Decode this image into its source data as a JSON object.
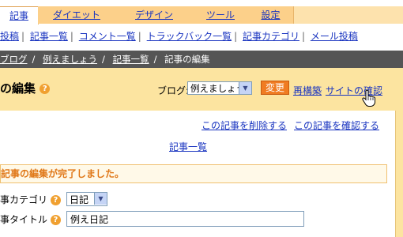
{
  "tabs": [
    "記事",
    "ダイエット",
    "デザイン",
    "ツール",
    "設定"
  ],
  "subnav": [
    "投稿",
    "記事一覧",
    "コメント一覧",
    "トラックバック一覧",
    "記事カテゴリ",
    "メール投稿"
  ],
  "breadcrumb": [
    "ブログ",
    "例えましょう",
    "記事一覧",
    "記事の編集"
  ],
  "page_title": "の編集",
  "blog_label": "ブログ:",
  "blog_value": "例えましょう",
  "change_label": "変更",
  "rebuild_label": "再構築",
  "confirm_site_label": "サイトの確認",
  "delete_link": "この記事を削除する",
  "confirm_link": "この記事を確認する",
  "list_link": "記事一覧",
  "message": "記事の編集が完了しました。",
  "category_label": "事カテゴリ",
  "category_value": "日記",
  "title_label": "事タイトル",
  "title_value": "例え日記",
  "help_glyph": "?",
  "colors": {
    "accent": "#f07c22",
    "panel": "#fce4a0",
    "tabbar": "#fcd08a",
    "link": "#1a35c0"
  }
}
